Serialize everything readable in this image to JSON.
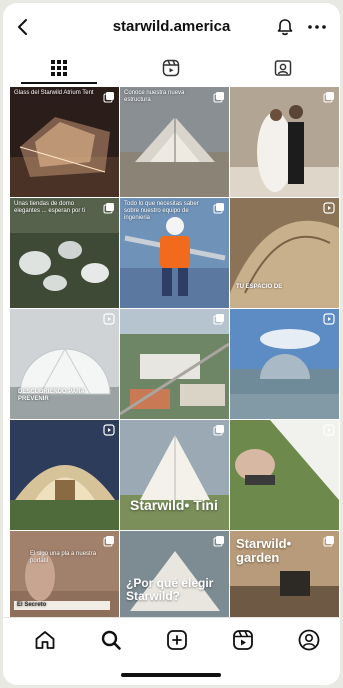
{
  "header": {
    "username": "starwild.america"
  },
  "icons": {
    "back": "chevron-left-icon",
    "bell": "bell-icon",
    "more": "more-horizontal-icon",
    "grid_tab": "grid-icon",
    "reels_tab": "reels-icon",
    "tagged_tab": "tagged-icon",
    "home": "home-icon",
    "search": "search-icon",
    "create": "plus-square-icon",
    "reels": "reels-icon",
    "profile": "profile-icon"
  },
  "posts": [
    {
      "caption": "Glass del Starwild Atrium Tent",
      "type": "carousel"
    },
    {
      "caption": "Conoce nuestra nueva estructura",
      "type": "carousel"
    },
    {
      "caption": "",
      "type": "carousel"
    },
    {
      "caption": "Unas tiendas de domo elegantes ... esperan por ti",
      "type": "carousel"
    },
    {
      "caption": "Todo lo que necesitas saber sobre nuestro equipo de ingenieria",
      "type": "carousel"
    },
    {
      "caption": "TU ESPACIO DE",
      "type": "reel"
    },
    {
      "caption": "DESCUBRIENDO PARA PREVENIR",
      "type": "reel"
    },
    {
      "caption": "",
      "type": "carousel"
    },
    {
      "caption": "",
      "type": "reel"
    },
    {
      "caption": "",
      "type": "reel"
    },
    {
      "caption": "Starwild• Tini",
      "type": "carousel"
    },
    {
      "caption": "",
      "type": "reel"
    },
    {
      "caption": "El Secreto",
      "type": "carousel",
      "subcaption": "El sigo una pla a nuestra portátil"
    },
    {
      "caption": "¿Por qué elegir Starwild?",
      "type": "carousel"
    },
    {
      "caption": "Starwild• garden",
      "type": "carousel"
    }
  ],
  "colors": {
    "accent": "#111111",
    "background": "#e9e9e4"
  }
}
